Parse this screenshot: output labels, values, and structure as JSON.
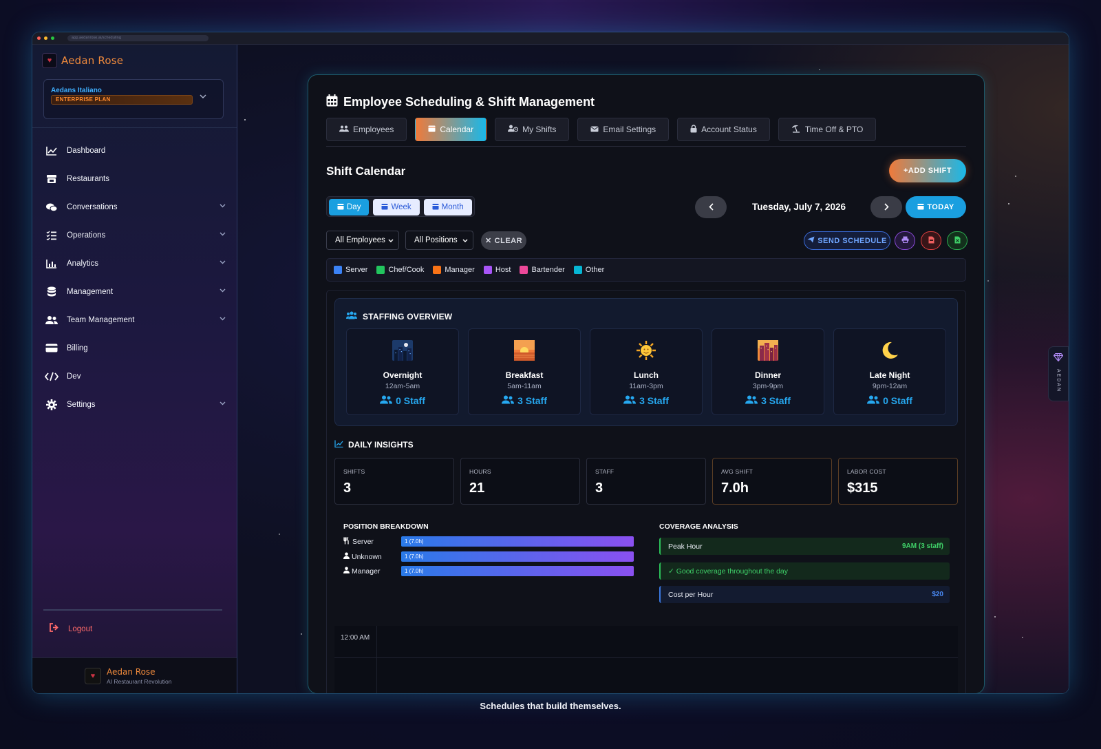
{
  "browser": {
    "url": "app.aedanrose.ai/scheduling"
  },
  "brand": {
    "name": "Aedan Rose",
    "org": "Aedans Italiano",
    "plan": "ENTERPRISE PLAN",
    "tagline": "AI Restaurant Revolution"
  },
  "sidebar": {
    "items": [
      {
        "label": "Dashboard",
        "icon": "chart-line-icon",
        "chevron": false
      },
      {
        "label": "Restaurants",
        "icon": "store-icon",
        "chevron": false
      },
      {
        "label": "Conversations",
        "icon": "chat-bubbles-icon",
        "chevron": true
      },
      {
        "label": "Operations",
        "icon": "list-check-icon",
        "chevron": true
      },
      {
        "label": "Analytics",
        "icon": "bar-chart-icon",
        "chevron": true
      },
      {
        "label": "Management",
        "icon": "database-icon",
        "chevron": true
      },
      {
        "label": "Team Management",
        "icon": "users-icon",
        "chevron": true
      },
      {
        "label": "Billing",
        "icon": "credit-card-icon",
        "chevron": false
      },
      {
        "label": "Dev",
        "icon": "code-icon",
        "chevron": false
      },
      {
        "label": "Settings",
        "icon": "gear-icon",
        "chevron": true
      }
    ],
    "logout": "Logout"
  },
  "page": {
    "title": "Employee Scheduling & Shift Management",
    "tabs": [
      {
        "label": "Employees",
        "active": false
      },
      {
        "label": "Calendar",
        "active": true
      },
      {
        "label": "My Shifts",
        "active": false
      },
      {
        "label": "Email Settings",
        "active": false
      },
      {
        "label": "Account Status",
        "active": false
      },
      {
        "label": "Time Off & PTO",
        "active": false
      }
    ]
  },
  "calendar": {
    "title": "Shift Calendar",
    "add_shift": "ADD SHIFT",
    "views": [
      "Day",
      "Week",
      "Month"
    ],
    "active_view": "Day",
    "date": "Tuesday, July 7, 2026",
    "today": "TODAY",
    "filters": {
      "employees": "All Employees",
      "positions": "All Positions",
      "clear": "CLEAR"
    },
    "send_schedule": "SEND SCHEDULE"
  },
  "legend": [
    {
      "label": "Server",
      "color": "#3b82f6"
    },
    {
      "label": "Chef/Cook",
      "color": "#22c55e"
    },
    {
      "label": "Manager",
      "color": "#f97316"
    },
    {
      "label": "Host",
      "color": "#a855f7"
    },
    {
      "label": "Bartender",
      "color": "#ec4899"
    },
    {
      "label": "Other",
      "color": "#06b6d4"
    }
  ],
  "staffing": {
    "title": "STAFFING OVERVIEW",
    "shifts": [
      {
        "name": "Overnight",
        "time": "12am-5am",
        "staff": "0 Staff",
        "icon": "night-city-icon"
      },
      {
        "name": "Breakfast",
        "time": "5am-11am",
        "staff": "3 Staff",
        "icon": "sunrise-icon"
      },
      {
        "name": "Lunch",
        "time": "11am-3pm",
        "staff": "3 Staff",
        "icon": "sun-icon"
      },
      {
        "name": "Dinner",
        "time": "3pm-9pm",
        "staff": "3 Staff",
        "icon": "city-dusk-icon"
      },
      {
        "name": "Late Night",
        "time": "9pm-12am",
        "staff": "0 Staff",
        "icon": "moon-icon"
      }
    ]
  },
  "insights": {
    "title": "DAILY INSIGHTS",
    "cards": [
      {
        "label": "SHIFTS",
        "value": "3"
      },
      {
        "label": "HOURS",
        "value": "21"
      },
      {
        "label": "STAFF",
        "value": "3"
      },
      {
        "label": "AVG SHIFT",
        "value": "7.0h"
      },
      {
        "label": "LABOR COST",
        "value": "$315"
      }
    ]
  },
  "position_breakdown": {
    "title": "POSITION BREAKDOWN",
    "rows": [
      {
        "label": "Server",
        "text": "1 (7.0h)",
        "fraction": 1.0,
        "icon": "utensils-icon"
      },
      {
        "label": "Unknown",
        "text": "1 (7.0h)",
        "fraction": 1.0,
        "icon": "user-icon"
      },
      {
        "label": "Manager",
        "text": "1 (7.0h)",
        "fraction": 1.0,
        "icon": "user-icon"
      }
    ]
  },
  "coverage": {
    "title": "COVERAGE ANALYSIS",
    "peak_label": "Peak Hour",
    "peak_value": "9AM (3 staff)",
    "status": "✓ Good coverage throughout the day",
    "cost_label": "Cost per Hour",
    "cost_value": "$20"
  },
  "timeline": {
    "first_label": "12:00 AM"
  },
  "side_tab": "AEDAN",
  "footer_caption": "Schedules that build themselves."
}
